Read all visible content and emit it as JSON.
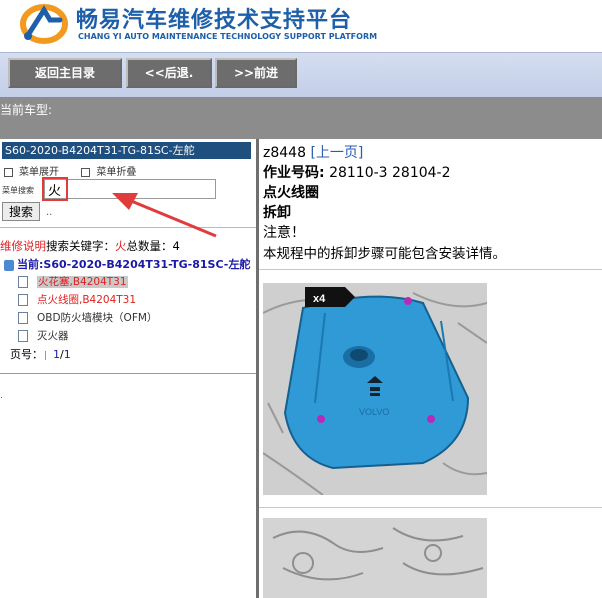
{
  "header": {
    "brand_cn": "畅易汽车维修技术支持平台",
    "brand_en": "CHANG YI AUTO MAINTENANCE TECHNOLOGY SUPPORT PLATFORM",
    "logo_icon": "chang-yi-logo",
    "colors": {
      "brand": "#1d5fa8",
      "logo_orange": "#f29a1f"
    }
  },
  "toolbar": {
    "home_label": "返回主目录",
    "back_label": "<<后退.",
    "forward_label": ">>前进"
  },
  "car_type": {
    "label": "当前车型:"
  },
  "left": {
    "model_header": "S60-2020-B4204T31-TG-81SC-左舵",
    "menu_expand": "菜单展开",
    "menu_collapse": "菜单折叠",
    "search_label": "菜单搜索",
    "search_value": "火",
    "search_button": "搜索",
    "search_dots": "..",
    "search_info": {
      "title": "维修说明",
      "keyword_label": "搜索关键字：",
      "keyword": "火",
      "count_label": "总数量：",
      "count": "4"
    },
    "tree": {
      "root": "当前:S60-2020-B4204T31-TG-81SC-左舵",
      "items": [
        {
          "label": "火花塞,B4204T31"
        },
        {
          "label": "点火线圈,B4204T31"
        },
        {
          "label": "OBD防火墙模块（OFM）"
        },
        {
          "label": "灭火器"
        }
      ]
    },
    "page": {
      "label": "页号：",
      "value": "1",
      "sep": "/",
      "total": "1"
    },
    "dot_link": "."
  },
  "right": {
    "doc_id": "z8448",
    "prev_link": "[上一页]",
    "op_code_label": "作业号码:",
    "op_code_value": "28110-3 28104-2",
    "part_name": "点火线圈",
    "section": "拆卸",
    "notice_title": "注意！",
    "notice_text": "本规程中的拆卸步骤可能包含安装详情。",
    "figure1": {
      "badge": "x4",
      "brand": "VOLVO",
      "colors": {
        "cover": "#2f9ad6",
        "bolt": "#b52bb8"
      }
    }
  },
  "annotation": {
    "color": "#e03c3c"
  }
}
